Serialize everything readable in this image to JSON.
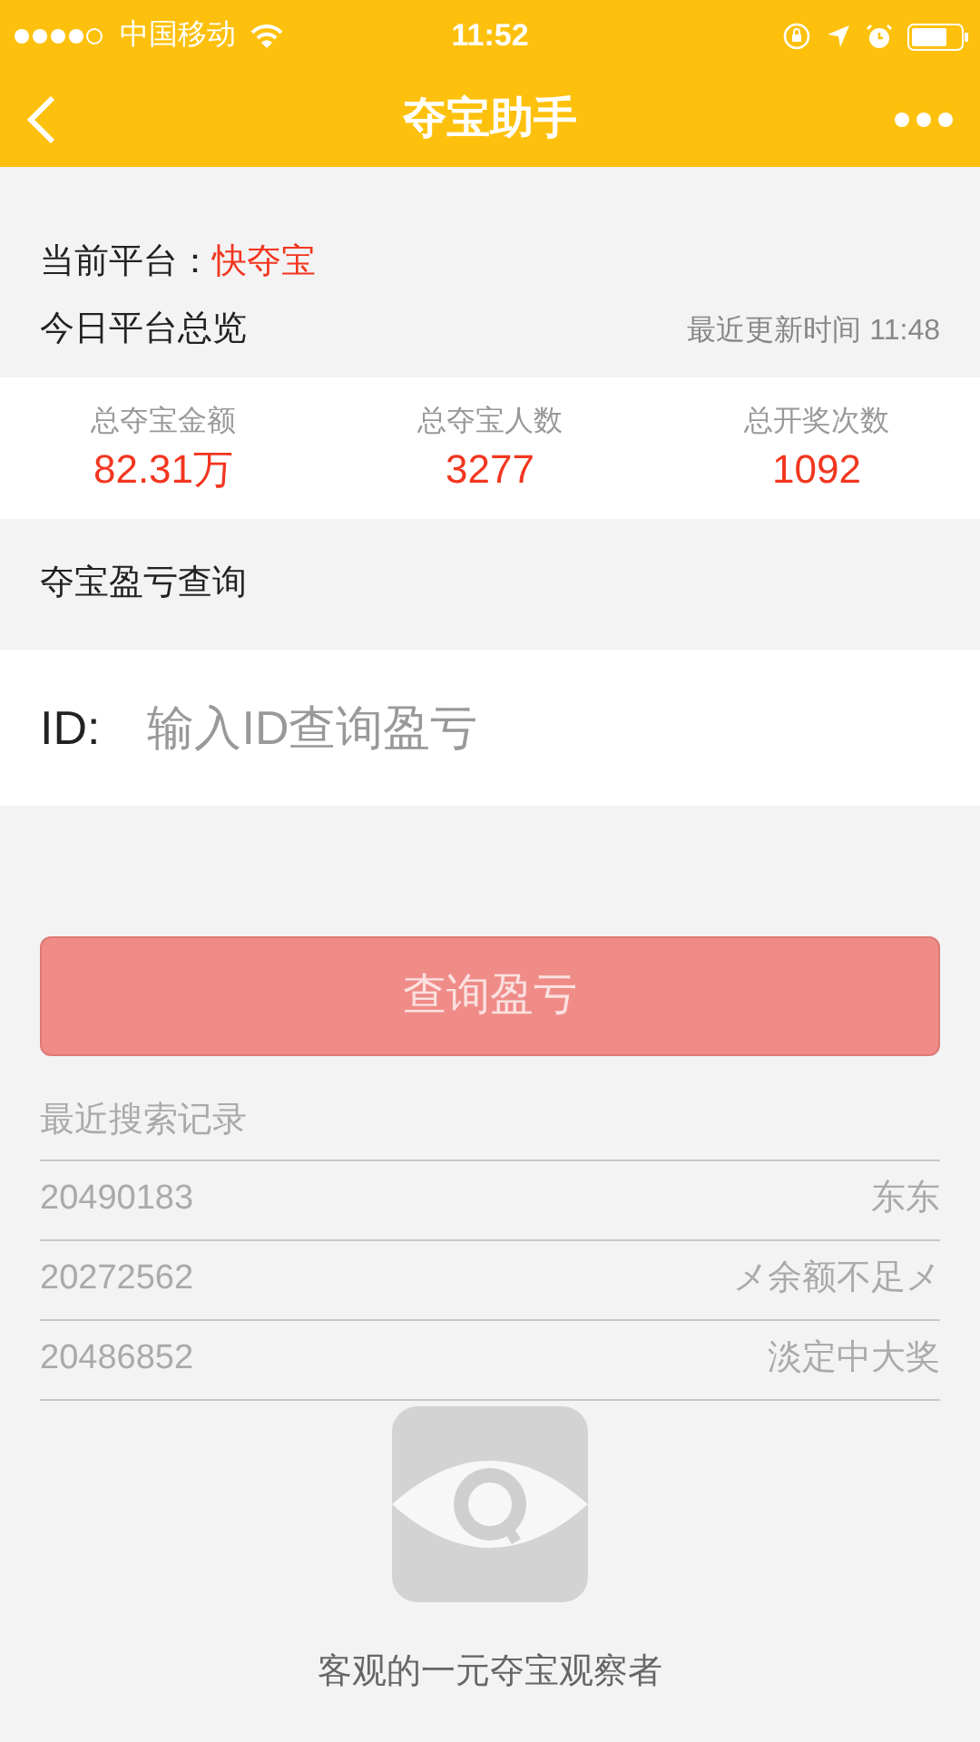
{
  "status_bar": {
    "carrier": "中国移动",
    "time": "11:52"
  },
  "nav": {
    "title": "夺宝助手"
  },
  "platform": {
    "label": "当前平台：",
    "value": "快夺宝"
  },
  "overview": {
    "title": "今日平台总览",
    "updated": "最近更新时间 11:48",
    "stats": [
      {
        "label": "总夺宝金额",
        "value": "82.31万"
      },
      {
        "label": "总夺宝人数",
        "value": "3277"
      },
      {
        "label": "总开奖次数",
        "value": "1092"
      }
    ]
  },
  "query": {
    "title": "夺宝盈亏查询",
    "field_label": "ID:",
    "placeholder": "输入ID查询盈亏",
    "button": "查询盈亏",
    "disabled": true
  },
  "recent": {
    "title": "最近搜索记录",
    "rows": [
      {
        "id": "20490183",
        "name": "东东"
      },
      {
        "id": "20272562",
        "name": "メ余额不足メ"
      },
      {
        "id": "20486852",
        "name": "淡定中大奖"
      }
    ]
  },
  "footer": {
    "tagline": "客观的一元夺宝观察者"
  }
}
